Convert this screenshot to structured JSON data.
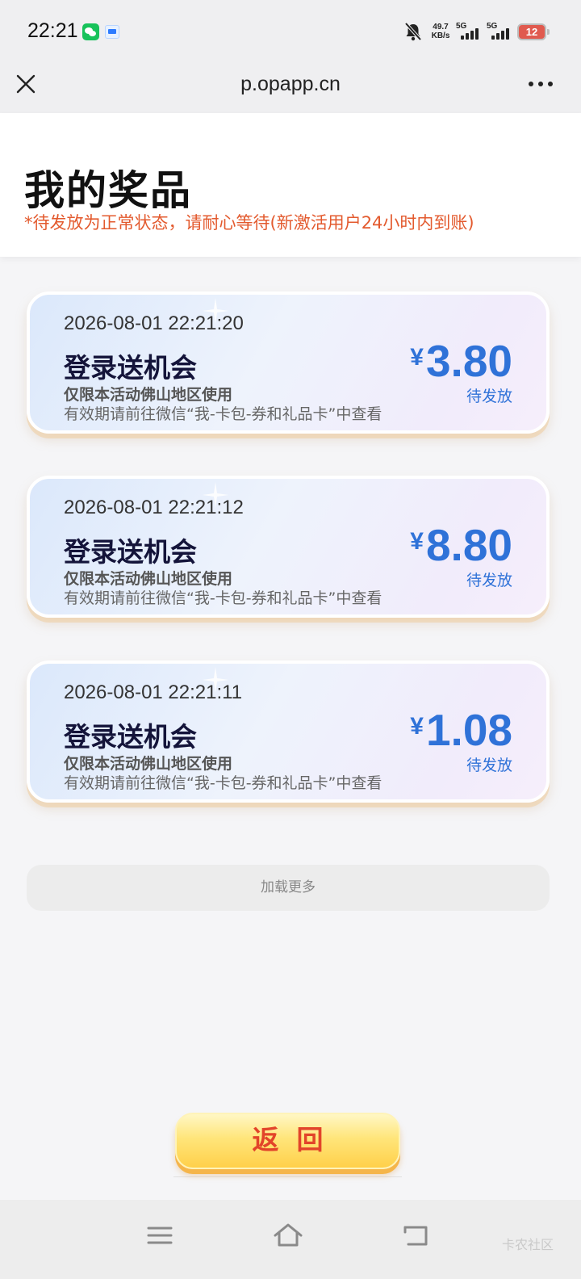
{
  "status_bar": {
    "time": "22:21",
    "net_speed_value": "49.7",
    "net_speed_unit": "KB/s",
    "sim1_label": "5G",
    "sim2_label": "5G",
    "battery_level": "12",
    "battery_color": "#e05a4f"
  },
  "title_bar": {
    "url": "p.opapp.cn"
  },
  "header": {
    "title": "我的奖品",
    "notice": "*待发放为正常状态，请耐心等待(新激活用户24小时内到账)",
    "notice_color": "#e35a2e"
  },
  "prizes": [
    {
      "date": "2026-08-01 22:21:20",
      "name": "登录送机会",
      "region": "仅限本活动佛山地区使用",
      "validity": "有效期请前往微信“我-卡包-券和礼品卡”中查看",
      "currency": "¥",
      "amount": "3.80",
      "status": "待发放"
    },
    {
      "date": "2026-08-01 22:21:12",
      "name": "登录送机会",
      "region": "仅限本活动佛山地区使用",
      "validity": "有效期请前往微信“我-卡包-券和礼品卡”中查看",
      "currency": "¥",
      "amount": "8.80",
      "status": "待发放"
    },
    {
      "date": "2026-08-01 22:21:11",
      "name": "登录送机会",
      "region": "仅限本活动佛山地区使用",
      "validity": "有效期请前往微信“我-卡包-券和礼品卡”中查看",
      "currency": "¥",
      "amount": "1.08",
      "status": "待发放"
    }
  ],
  "load_more_label": "加载更多",
  "return_label": "返回",
  "accent_color": "#2f72d8",
  "watermark": "卡农社区",
  "icons": {
    "close": "close-icon",
    "more": "more-icon",
    "menu": "menu-icon",
    "home": "home-icon",
    "back": "back-icon"
  }
}
